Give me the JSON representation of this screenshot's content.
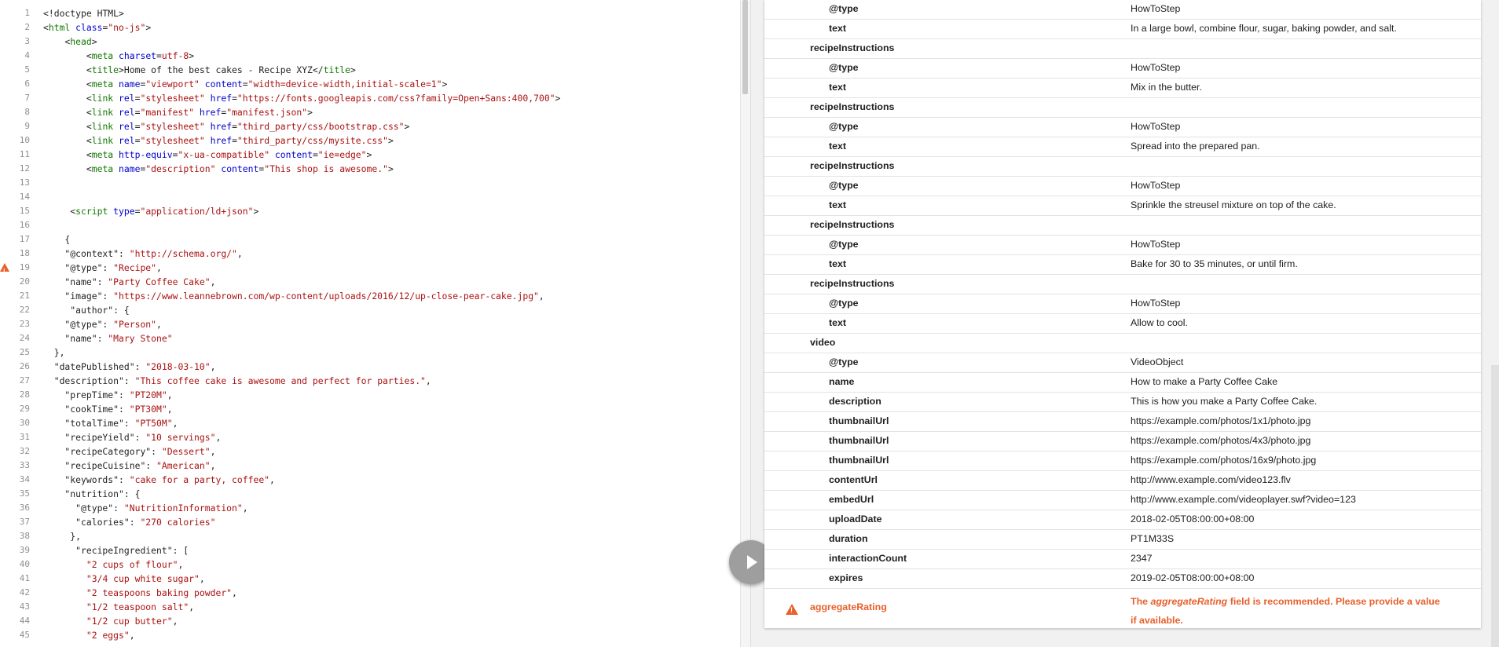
{
  "editor": {
    "lines": [
      {
        "n": "1",
        "html": "&lt;!doctype HTML&gt;"
      },
      {
        "n": "2",
        "html": "&lt;<span class='tg'>html</span> <span class='at'>class</span>=<span class='st'>\"no-js\"</span>&gt;"
      },
      {
        "n": "3",
        "html": "    &lt;<span class='tg'>head</span>&gt;"
      },
      {
        "n": "4",
        "html": "        &lt;<span class='tg'>meta</span> <span class='at'>charset</span>=<span class='st'>utf-8</span>&gt;"
      },
      {
        "n": "5",
        "html": "        &lt;<span class='tg'>title</span>&gt;Home of the best cakes - Recipe XYZ&lt;/<span class='tg'>title</span>&gt;"
      },
      {
        "n": "6",
        "html": "        &lt;<span class='tg'>meta</span> <span class='at'>name</span>=<span class='st'>\"viewport\"</span> <span class='at'>content</span>=<span class='st'>\"width=device-width,initial-scale=1\"</span>&gt;"
      },
      {
        "n": "7",
        "html": "        &lt;<span class='tg'>link</span> <span class='at'>rel</span>=<span class='st'>\"stylesheet\"</span> <span class='at'>href</span>=<span class='st'>\"https://fonts.googleapis.com/css?family=Open+Sans:400,700\"</span>&gt;"
      },
      {
        "n": "8",
        "html": "        &lt;<span class='tg'>link</span> <span class='at'>rel</span>=<span class='st'>\"manifest\"</span> <span class='at'>href</span>=<span class='st'>\"manifest.json\"</span>&gt;"
      },
      {
        "n": "9",
        "html": "        &lt;<span class='tg'>link</span> <span class='at'>rel</span>=<span class='st'>\"stylesheet\"</span> <span class='at'>href</span>=<span class='st'>\"third_party/css/bootstrap.css\"</span>&gt;"
      },
      {
        "n": "10",
        "html": "        &lt;<span class='tg'>link</span> <span class='at'>rel</span>=<span class='st'>\"stylesheet\"</span> <span class='at'>href</span>=<span class='st'>\"third_party/css/mysite.css\"</span>&gt;"
      },
      {
        "n": "11",
        "html": "        &lt;<span class='tg'>meta</span> <span class='at'>http-equiv</span>=<span class='st'>\"x-ua-compatible\"</span> <span class='at'>content</span>=<span class='st'>\"ie=edge\"</span>&gt;"
      },
      {
        "n": "12",
        "html": "        &lt;<span class='tg'>meta</span> <span class='at'>name</span>=<span class='st'>\"description\"</span> <span class='at'>content</span>=<span class='st'>\"This shop is awesome.\"</span>&gt;"
      },
      {
        "n": "13",
        "html": ""
      },
      {
        "n": "14",
        "html": ""
      },
      {
        "n": "15",
        "html": "     &lt;<span class='tg'>script</span> <span class='at'>type</span>=<span class='st'>\"application/ld+json\"</span>&gt;"
      },
      {
        "n": "16",
        "html": ""
      },
      {
        "n": "17",
        "html": "    {"
      },
      {
        "n": "18",
        "html": "    \"@context\": <span class='st'>\"http://schema.org/\"</span>,"
      },
      {
        "n": "19",
        "html": "    \"@type\": <span class='st'>\"Recipe\"</span>,",
        "warn": true
      },
      {
        "n": "20",
        "html": "    \"name\": <span class='st'>\"Party Coffee Cake\"</span>,"
      },
      {
        "n": "21",
        "html": "    \"image\": <span class='st'>\"https://www.leannebrown.com/wp-content/uploads/2016/12/up-close-pear-cake.jpg\"</span>,"
      },
      {
        "n": "22",
        "html": "     \"author\": {"
      },
      {
        "n": "23",
        "html": "    \"@type\": <span class='st'>\"Person\"</span>,"
      },
      {
        "n": "24",
        "html": "    \"name\": <span class='st'>\"Mary Stone\"</span>"
      },
      {
        "n": "25",
        "html": "  },"
      },
      {
        "n": "26",
        "html": "  \"datePublished\": <span class='st'>\"2018-03-10\"</span>,"
      },
      {
        "n": "27",
        "html": "  \"description\": <span class='st'>\"This coffee cake is awesome and perfect for parties.\"</span>,"
      },
      {
        "n": "28",
        "html": "    \"prepTime\": <span class='st'>\"PT20M\"</span>,"
      },
      {
        "n": "29",
        "html": "    \"cookTime\": <span class='st'>\"PT30M\"</span>,"
      },
      {
        "n": "30",
        "html": "    \"totalTime\": <span class='st'>\"PT50M\"</span>,"
      },
      {
        "n": "31",
        "html": "    \"recipeYield\": <span class='st'>\"10 servings\"</span>,"
      },
      {
        "n": "32",
        "html": "    \"recipeCategory\": <span class='st'>\"Dessert\"</span>,"
      },
      {
        "n": "33",
        "html": "    \"recipeCuisine\": <span class='st'>\"American\"</span>,"
      },
      {
        "n": "34",
        "html": "    \"keywords\": <span class='st'>\"cake for a party, coffee\"</span>,"
      },
      {
        "n": "35",
        "html": "    \"nutrition\": {"
      },
      {
        "n": "36",
        "html": "      \"@type\": <span class='st'>\"NutritionInformation\"</span>,"
      },
      {
        "n": "37",
        "html": "      \"calories\": <span class='st'>\"270 calories\"</span>"
      },
      {
        "n": "38",
        "html": "     },"
      },
      {
        "n": "39",
        "html": "      \"recipeIngredient\": ["
      },
      {
        "n": "40",
        "html": "        <span class='st'>\"2 cups of flour\"</span>,"
      },
      {
        "n": "41",
        "html": "        <span class='st'>\"3/4 cup white sugar\"</span>,"
      },
      {
        "n": "42",
        "html": "        <span class='st'>\"2 teaspoons baking powder\"</span>,"
      },
      {
        "n": "43",
        "html": "        <span class='st'>\"1/2 teaspoon salt\"</span>,"
      },
      {
        "n": "44",
        "html": "        <span class='st'>\"1/2 cup butter\"</span>,"
      },
      {
        "n": "45",
        "html": "        <span class='st'>\"2 eggs\"</span>,"
      }
    ]
  },
  "results": {
    "rows": [
      {
        "level": 1,
        "key": "@type",
        "value": "HowToStep"
      },
      {
        "level": 1,
        "key": "text",
        "value": "In a large bowl, combine flour, sugar, baking powder, and salt."
      },
      {
        "level": 0,
        "key": "recipeInstructions",
        "value": ""
      },
      {
        "level": 1,
        "key": "@type",
        "value": "HowToStep"
      },
      {
        "level": 1,
        "key": "text",
        "value": "Mix in the butter."
      },
      {
        "level": 0,
        "key": "recipeInstructions",
        "value": ""
      },
      {
        "level": 1,
        "key": "@type",
        "value": "HowToStep"
      },
      {
        "level": 1,
        "key": "text",
        "value": "Spread into the prepared pan."
      },
      {
        "level": 0,
        "key": "recipeInstructions",
        "value": ""
      },
      {
        "level": 1,
        "key": "@type",
        "value": "HowToStep"
      },
      {
        "level": 1,
        "key": "text",
        "value": "Sprinkle the streusel mixture on top of the cake."
      },
      {
        "level": 0,
        "key": "recipeInstructions",
        "value": ""
      },
      {
        "level": 1,
        "key": "@type",
        "value": "HowToStep"
      },
      {
        "level": 1,
        "key": "text",
        "value": "Bake for 30 to 35 minutes, or until firm."
      },
      {
        "level": 0,
        "key": "recipeInstructions",
        "value": ""
      },
      {
        "level": 1,
        "key": "@type",
        "value": "HowToStep"
      },
      {
        "level": 1,
        "key": "text",
        "value": "Allow to cool."
      },
      {
        "level": 0,
        "key": "video",
        "value": ""
      },
      {
        "level": 1,
        "key": "@type",
        "value": "VideoObject"
      },
      {
        "level": 1,
        "key": "name",
        "value": "How to make a Party Coffee Cake"
      },
      {
        "level": 1,
        "key": "description",
        "value": "This is how you make a Party Coffee Cake."
      },
      {
        "level": 1,
        "key": "thumbnailUrl",
        "value": "https://example.com/photos/1x1/photo.jpg"
      },
      {
        "level": 1,
        "key": "thumbnailUrl",
        "value": "https://example.com/photos/4x3/photo.jpg"
      },
      {
        "level": 1,
        "key": "thumbnailUrl",
        "value": "https://example.com/photos/16x9/photo.jpg"
      },
      {
        "level": 1,
        "key": "contentUrl",
        "value": "http://www.example.com/video123.flv"
      },
      {
        "level": 1,
        "key": "embedUrl",
        "value": "http://www.example.com/videoplayer.swf?video=123"
      },
      {
        "level": 1,
        "key": "uploadDate",
        "value": "2018-02-05T08:00:00+08:00"
      },
      {
        "level": 1,
        "key": "duration",
        "value": "PT1M33S"
      },
      {
        "level": 1,
        "key": "interactionCount",
        "value": "2347"
      },
      {
        "level": 1,
        "key": "expires",
        "value": "2019-02-05T08:00:00+08:00"
      }
    ],
    "aggregate": {
      "key": "aggregateRating",
      "msg_prefix": "The ",
      "msg_field": "aggregateRating",
      "msg_suffix": " field is recommended. Please provide a value if available."
    }
  },
  "colors": {
    "warning": "#e8602c",
    "tag": "#117700",
    "attr": "#0000cc",
    "string": "#aa1111"
  },
  "icons": {
    "play": "play-icon",
    "warning": "warning-icon"
  }
}
